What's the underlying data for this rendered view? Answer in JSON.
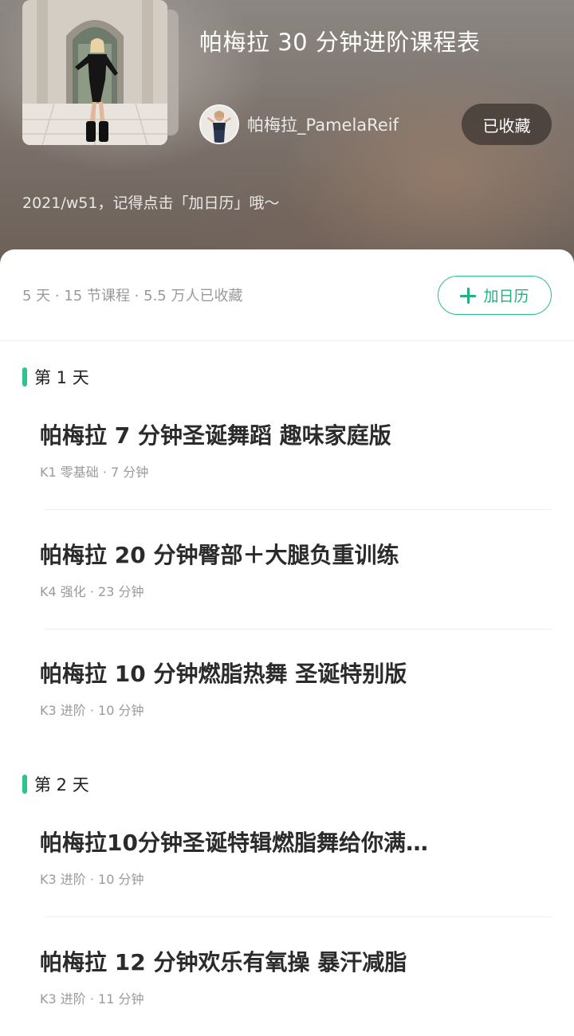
{
  "playlist": {
    "title": "帕梅拉 30 分钟进阶课程表",
    "author": "帕梅拉_PamelaReif",
    "favorite_label": "已收藏",
    "tip": "2021/w51，记得点击「加日历」哦～"
  },
  "summary": {
    "stats": "5 天 · 15 节课程 · 5.5 万人已收藏",
    "calendar_label": "加日历"
  },
  "days": [
    {
      "label": "第 1 天",
      "courses": [
        {
          "title": "帕梅拉 7 分钟圣诞舞蹈 趣味家庭版",
          "meta": "K1 零基础 · 7 分钟"
        },
        {
          "title": "帕梅拉 20 分钟臀部＋大腿负重训练",
          "meta": "K4 强化 · 23 分钟"
        },
        {
          "title": "帕梅拉 10 分钟燃脂热舞 圣诞特别版",
          "meta": "K3 进阶 · 10 分钟"
        }
      ]
    },
    {
      "label": "第 2 天",
      "courses": [
        {
          "title": "帕梅拉10分钟圣诞特辑燃脂舞给你满…",
          "meta": "K3 进阶 · 10 分钟"
        },
        {
          "title": "帕梅拉 12 分钟欢乐有氧操 暴汗减脂",
          "meta": "K3 进阶 · 11 分钟"
        }
      ]
    }
  ],
  "colors": {
    "accent": "#26c08a",
    "title_text": "#2b2b2b",
    "meta_text": "#9a9a9a"
  },
  "icons": {
    "calendar_add": "plus-icon"
  }
}
